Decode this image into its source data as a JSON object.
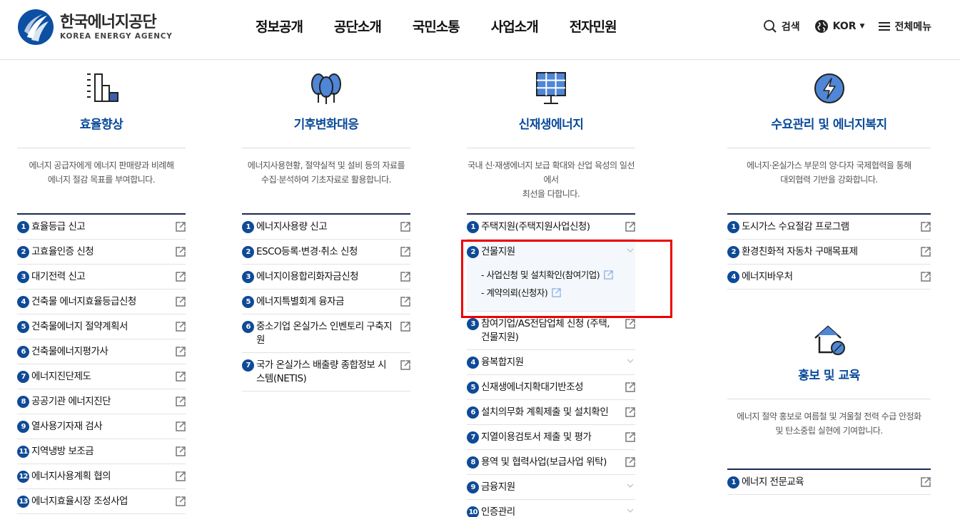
{
  "header": {
    "logo_ko": "한국에너지공단",
    "logo_en": "KOREA ENERGY AGENCY",
    "nav": [
      "정보공개",
      "공단소개",
      "국민소통",
      "사업소개",
      "전자민원"
    ],
    "search_label": "검색",
    "lang_label": "KOR",
    "menu_label": "전체메뉴"
  },
  "columns": [
    {
      "title": "효율향상",
      "icon": "building-chart-icon",
      "desc": [
        "에너지 공급자에게 에너지 판매량과 비례해",
        "에너지 절감 목표를 부여합니다."
      ],
      "items": [
        {
          "n": "1",
          "label": "효율등급 신고"
        },
        {
          "n": "2",
          "label": "고효율인증 신청"
        },
        {
          "n": "3",
          "label": "대기전력 신고"
        },
        {
          "n": "4",
          "label": "건축물 에너지효율등급신청"
        },
        {
          "n": "5",
          "label": "건축물에너지 절약계획서"
        },
        {
          "n": "6",
          "label": "건축물에너지평가사"
        },
        {
          "n": "7",
          "label": "에너지진단제도"
        },
        {
          "n": "8",
          "label": "공공기관 에너지진단"
        },
        {
          "n": "9",
          "label": "열사용기자재 검사"
        },
        {
          "n": "11",
          "label": "지역냉방 보조금"
        },
        {
          "n": "12",
          "label": "에너지사용계획 협의"
        },
        {
          "n": "13",
          "label": "에너지효율시장 조성사업"
        }
      ]
    },
    {
      "title": "기후변화대응",
      "icon": "trees-icon",
      "desc": [
        "에너지사용현황, 절약실적 및 설비 등의 자료를",
        "수집·분석하여 기초자료로 활용합니다."
      ],
      "items": [
        {
          "n": "1",
          "label": "에너지사용량 신고"
        },
        {
          "n": "2",
          "label": "ESCO등록·변경·취소 신청"
        },
        {
          "n": "3",
          "label": "에너지이용합리화자금신청"
        },
        {
          "n": "5",
          "label": "에너지특별회계 융자금"
        },
        {
          "n": "6",
          "label": "중소기업 온실가스 인벤토리 구축지원"
        },
        {
          "n": "7",
          "label": "국가 온실가스 배출량 종합정보 시스템(NETIS)"
        }
      ]
    },
    {
      "title": "신재생에너지",
      "icon": "solar-panel-icon",
      "desc": [
        "국내 신·재생에너지 보급 확대와 산업 육성의 일선에서",
        "최선을 다합니다."
      ],
      "items": [
        {
          "n": "1",
          "label": "주택지원(주택지원사업신청)",
          "kind": "ext"
        },
        {
          "n": "2",
          "label": "건물지원",
          "kind": "open",
          "subs": [
            "- 사업신청 및 설치확인(참여기업)",
            "- 계약의뢰(신청자)"
          ]
        },
        {
          "n": "3",
          "label": "참여기업/AS전담업체 신청 (주택, 건물지원)",
          "kind": "ext"
        },
        {
          "n": "4",
          "label": "융복합지원",
          "kind": "chev"
        },
        {
          "n": "5",
          "label": "신재생에너지확대기반조성",
          "kind": "ext"
        },
        {
          "n": "6",
          "label": "설치의무화 계획제출 및 설치확인",
          "kind": "ext"
        },
        {
          "n": "7",
          "label": "지열이용검토서 제출 및 평가",
          "kind": "ext"
        },
        {
          "n": "8",
          "label": "용역 및 협력사업(보급사업 위탁)",
          "kind": "ext"
        },
        {
          "n": "9",
          "label": "금융지원",
          "kind": "chev"
        },
        {
          "n": "10",
          "label": "인증관리",
          "kind": "chev"
        }
      ]
    },
    {
      "title": "수요관리 및 에너지복지",
      "icon": "lightning-icon",
      "desc": [
        "에너지·온실가스 부문의 양·다자 국제협력을 통해",
        "대외협력 기반을 강화합니다."
      ],
      "items": [
        {
          "n": "1",
          "label": "도시가스 수요절감 프로그램"
        },
        {
          "n": "2",
          "label": "환경친화적 자동차 구매목표제"
        },
        {
          "n": "4",
          "label": "에너지바우처"
        }
      ]
    },
    {
      "title": "홍보 및 교육",
      "icon": "house-leaf-icon",
      "desc": [
        "에너지 절약 홍보로 여름철 및 겨울철 전력 수급 안정화",
        "및 탄소중립 실현에 기여합니다."
      ],
      "items": [
        {
          "n": "1",
          "label": "에너지 전문교육"
        }
      ]
    }
  ]
}
